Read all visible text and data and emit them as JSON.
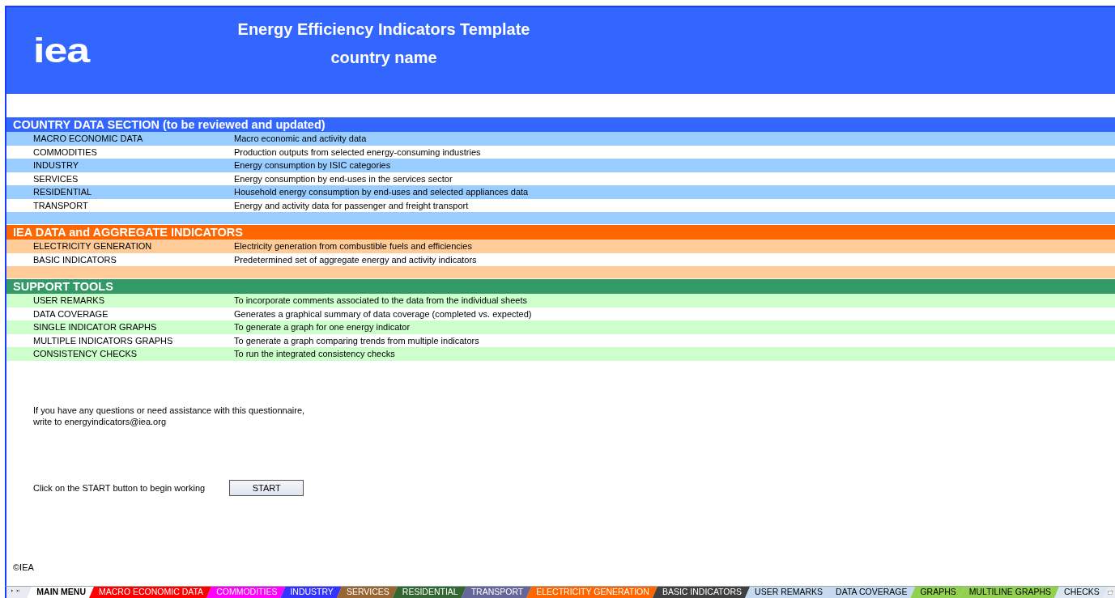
{
  "logo": "iea",
  "title": "Energy Efficiency Indicators Template",
  "subtitle": "country name",
  "sections": [
    {
      "kind": "country",
      "title": "COUNTRY DATA SECTION (to be reviewed and updated)",
      "trailing_band": true,
      "rows": [
        {
          "name": "MACRO ECONOMIC DATA",
          "description": "Macro economic and activity data"
        },
        {
          "name": "COMMODITIES",
          "description": "Production outputs from selected energy-consuming industries"
        },
        {
          "name": "INDUSTRY",
          "description": "Energy consumption by ISIC categories"
        },
        {
          "name": "SERVICES",
          "description": "Energy consumption by end-uses in the services sector"
        },
        {
          "name": "RESIDENTIAL",
          "description": "Household energy consumption by end-uses and selected appliances data"
        },
        {
          "name": "TRANSPORT",
          "description": "Energy and activity data for passenger and freight transport"
        }
      ]
    },
    {
      "kind": "iea",
      "title": "IEA DATA and AGGREGATE INDICATORS",
      "trailing_band": true,
      "rows": [
        {
          "name": "ELECTRICITY GENERATION",
          "description": "Electricity generation from combustible fuels and efficiencies"
        },
        {
          "name": "BASIC INDICATORS",
          "description": "Predetermined set of aggregate energy and activity indicators"
        }
      ]
    },
    {
      "kind": "support",
      "title": "SUPPORT TOOLS",
      "trailing_band": false,
      "rows": [
        {
          "name": "USER REMARKS",
          "description": "To incorporate comments associated to the data from the individual sheets"
        },
        {
          "name": "DATA COVERAGE",
          "description": "Generates a graphical summary of data coverage (completed vs. expected)"
        },
        {
          "name": "SINGLE INDICATOR GRAPHS",
          "description": "To generate a graph for one energy indicator"
        },
        {
          "name": "MULTIPLE INDICATORS GRAPHS",
          "description": "To generate a graph comparing trends from multiple indicators"
        },
        {
          "name": "CONSISTENCY CHECKS",
          "description": "To run the integrated consistency checks"
        }
      ]
    }
  ],
  "contact_lines": [
    "If you have any questions or need assistance with this questionnaire,",
    "write to energyindicators@iea.org"
  ],
  "start": {
    "prompt": "Click on the START button to begin working",
    "button": "START"
  },
  "copyright": "©IEA",
  "sheet_tabs": [
    {
      "label": "MAIN MENU",
      "selected": true,
      "color": "#ffffff"
    },
    {
      "label": "MACRO ECONOMIC DATA",
      "selected": false,
      "color": "#ff0000"
    },
    {
      "label": "COMMODITIES",
      "selected": false,
      "color": "#ff00ff"
    },
    {
      "label": "INDUSTRY",
      "selected": false,
      "color": "#3333ff"
    },
    {
      "label": "SERVICES",
      "selected": false,
      "color": "#996633"
    },
    {
      "label": "RESIDENTIAL",
      "selected": false,
      "color": "#336633"
    },
    {
      "label": "TRANSPORT",
      "selected": false,
      "color": "#666699"
    },
    {
      "label": "ELECTRICITY GENERATION",
      "selected": false,
      "color": "#ff6600"
    },
    {
      "label": "BASIC INDICATORS",
      "selected": false,
      "color": "#404040"
    },
    {
      "label": "USER REMARKS",
      "selected": false,
      "color": "#c5d9f1"
    },
    {
      "label": "DATA COVERAGE",
      "selected": false,
      "color": "#c5d9f1"
    },
    {
      "label": "GRAPHS",
      "selected": false,
      "color": "#92d050"
    },
    {
      "label": "MULTILINE GRAPHS",
      "selected": false,
      "color": "#92d050"
    },
    {
      "label": "CHECKS",
      "selected": false,
      "color": "#dce6f1"
    }
  ]
}
